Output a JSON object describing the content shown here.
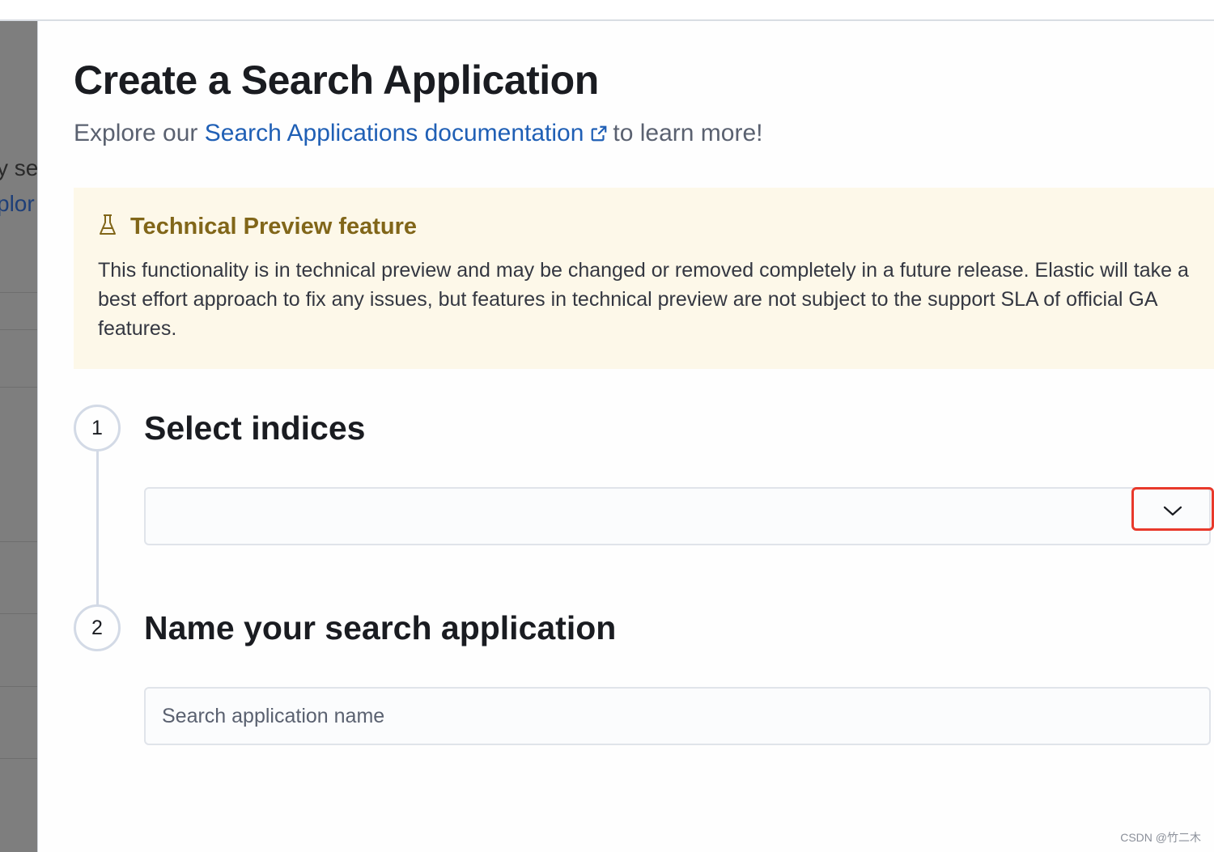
{
  "backdrop": {
    "fragment_line1": "y se",
    "fragment_line2": "plor"
  },
  "flyout": {
    "title": "Create a Search Application",
    "subtitle_prefix": "Explore our",
    "doc_link_label": "Search Applications documentation",
    "subtitle_suffix": "to learn more!"
  },
  "callout": {
    "icon": "beaker-icon",
    "title": "Technical Preview feature",
    "body": "This functionality is in technical preview and may be changed or removed completely in a future release. Elastic will take a best effort approach to fix any issues, but features in technical preview are not subject to the support SLA of official GA features."
  },
  "steps": [
    {
      "number": "1",
      "title": "Select indices",
      "combobox_value": ""
    },
    {
      "number": "2",
      "title": "Name your search application",
      "input_placeholder": "Search application name",
      "input_value": ""
    }
  ],
  "colors": {
    "link": "#1f5fb5",
    "callout_bg": "#fdf8e9",
    "callout_title": "#816619",
    "highlight": "#e8392b"
  },
  "watermark": "CSDN @竹二木"
}
